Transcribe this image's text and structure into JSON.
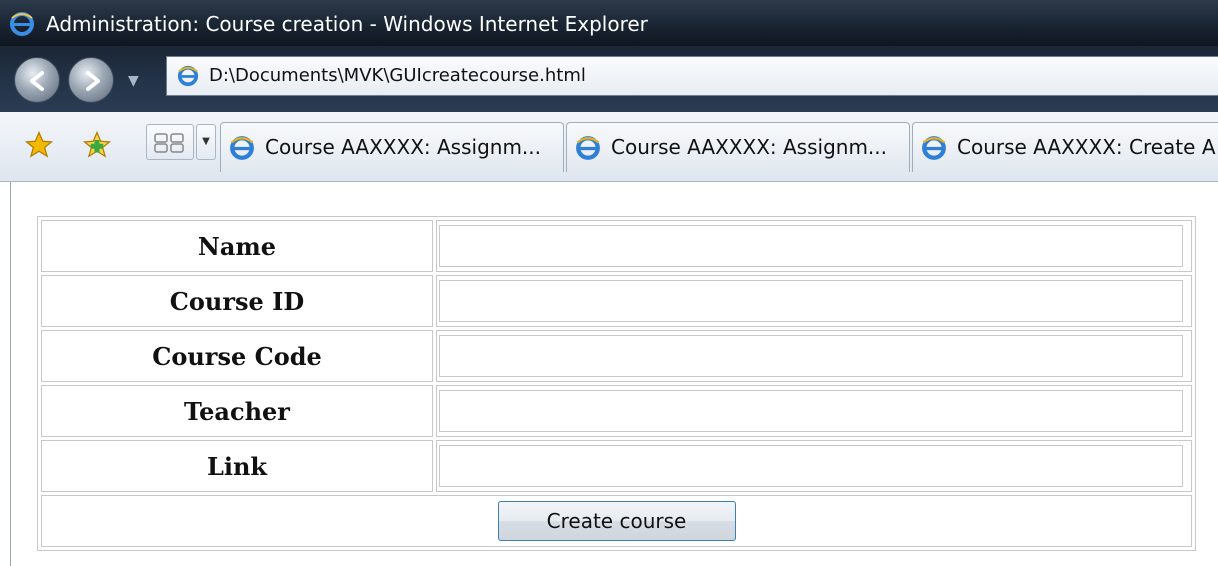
{
  "window": {
    "title": "Administration: Course creation - Windows Internet Explorer"
  },
  "navigation": {
    "address_url": "D:\\Documents\\MVK\\GUIcreatecourse.html"
  },
  "tabs": [
    {
      "label": "Course AAXXXX: Assignm..."
    },
    {
      "label": "Course AAXXXX: Assignm..."
    },
    {
      "label": "Course AAXXXX: Create A"
    }
  ],
  "form": {
    "fields": [
      {
        "label": "Name",
        "value": ""
      },
      {
        "label": "Course ID",
        "value": ""
      },
      {
        "label": "Course Code",
        "value": ""
      },
      {
        "label": "Teacher",
        "value": ""
      },
      {
        "label": "Link",
        "value": ""
      }
    ],
    "submit_label": "Create course"
  },
  "icons": [
    "ie-icon",
    "back-arrow-icon",
    "forward-arrow-icon",
    "favorites-star-icon",
    "add-favorite-icon",
    "quick-tabs-icon"
  ],
  "colors": {
    "titlebar": "#1a2533",
    "button_border": "#3c7fb1"
  }
}
